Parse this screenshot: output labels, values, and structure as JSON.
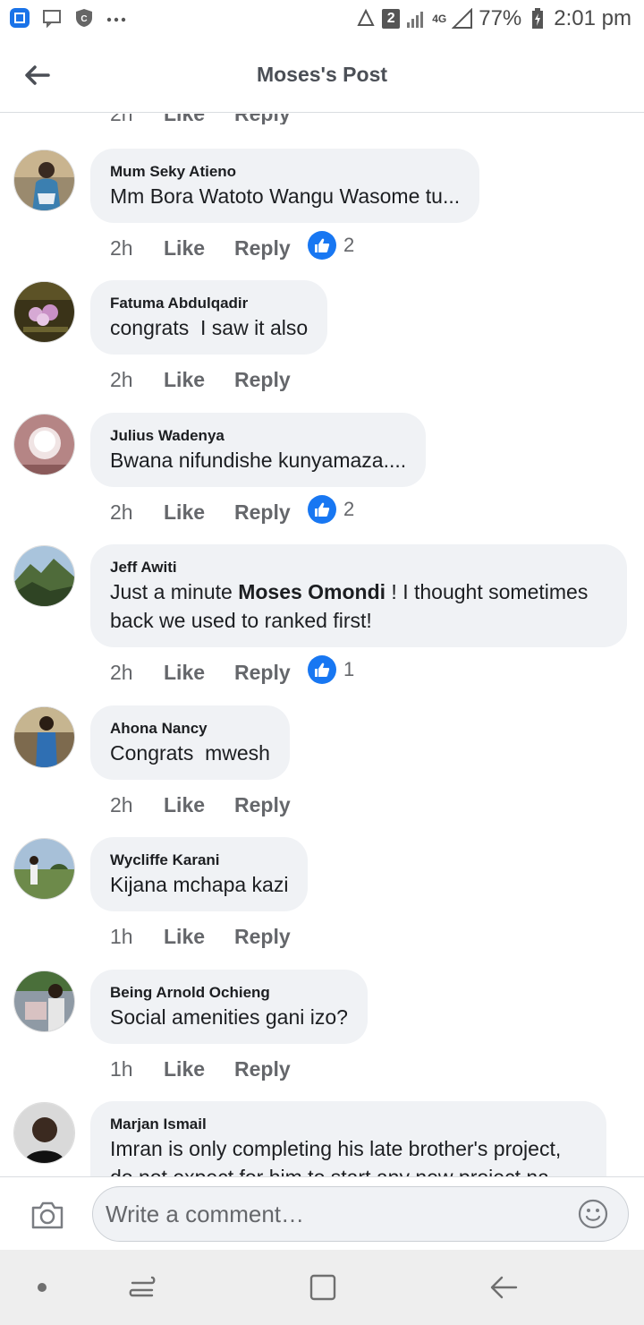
{
  "status_bar": {
    "badge": "2",
    "network": "4G",
    "battery": "77%",
    "time": "2:01 pm"
  },
  "header": {
    "title": "Moses's Post"
  },
  "partial_top": {
    "time": "2h",
    "like": "Like",
    "reply": "Reply"
  },
  "comments": [
    {
      "author": "Mum Seky Atieno",
      "text": "Mm Bora Watoto Wangu Wasome tu...",
      "time": "2h",
      "like": "Like",
      "reply": "Reply",
      "reactions": "2"
    },
    {
      "author": "Fatuma Abdulqadir",
      "text": "congrats  I saw it also",
      "time": "2h",
      "like": "Like",
      "reply": "Reply"
    },
    {
      "author": "Julius Wadenya",
      "text": "Bwana nifundishe kunyamaza....",
      "time": "2h",
      "like": "Like",
      "reply": "Reply",
      "reactions": "2"
    },
    {
      "author": "Jeff Awiti",
      "text_before": "Just a minute ",
      "mention": "Moses Omondi",
      "text_after": " ! I thought sometimes back we used to ranked first!",
      "time": "2h",
      "like": "Like",
      "reply": "Reply",
      "reactions": "1"
    },
    {
      "author": "Ahona Nancy",
      "text": "Congrats  mwesh",
      "time": "2h",
      "like": "Like",
      "reply": "Reply"
    },
    {
      "author": "Wycliffe Karani",
      "text": "Kijana mchapa kazi",
      "time": "1h",
      "like": "Like",
      "reply": "Reply"
    },
    {
      "author": "Being Arnold Ochieng",
      "text": "Social amenities gani izo?",
      "time": "1h",
      "like": "Like",
      "reply": "Reply"
    },
    {
      "author": "Marjan Ismail",
      "text": "Imran is only completing his late brother's project, do not expect for him to start any new project na"
    }
  ],
  "composer": {
    "placeholder": "Write a comment…"
  },
  "colors": {
    "bubble": "#f0f2f5",
    "like_blue": "#1877f2",
    "meta_gray": "#65676b"
  }
}
